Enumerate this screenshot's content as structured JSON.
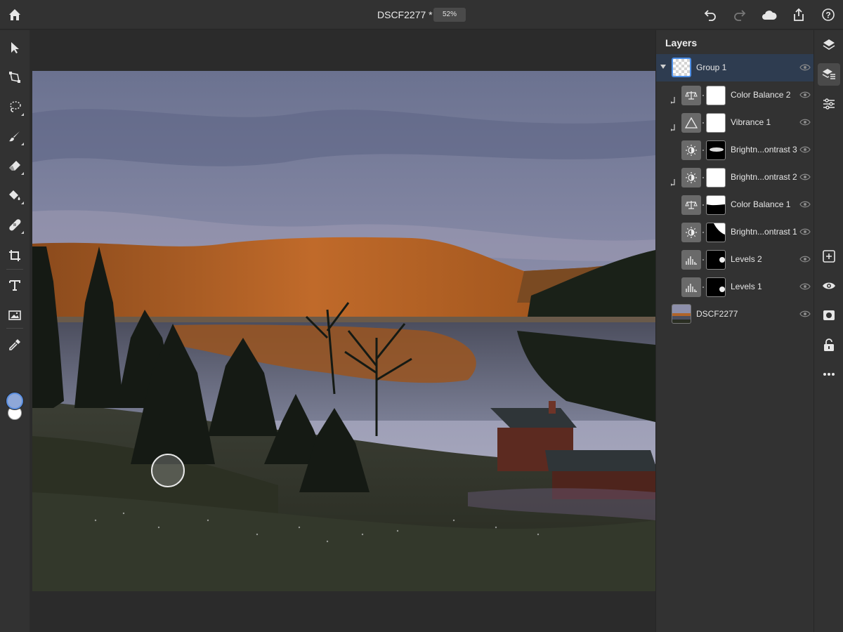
{
  "document": {
    "title": "DSCF2277 *",
    "zoom": "52%"
  },
  "topbar": {
    "icons": [
      "home-icon",
      "undo-icon",
      "redo-icon",
      "cloud-icon",
      "share-icon",
      "help-icon"
    ]
  },
  "toolbar": {
    "tools": [
      "select-icon",
      "transform-icon",
      "lasso-icon",
      "brush-icon",
      "eraser-icon",
      "fill-icon",
      "healing-icon",
      "crop-icon",
      "type-icon",
      "image-icon",
      "eyedropper-icon"
    ],
    "foreground_color": "#8fa8d8",
    "background_color": "#ffffff"
  },
  "layers": {
    "title": "Layers",
    "items": [
      {
        "name": "Group 1",
        "kind": "group",
        "selected": true
      },
      {
        "name": "Color Balance 2",
        "kind": "adjustment",
        "icon": "balance-icon",
        "clipped": true,
        "mask": "white"
      },
      {
        "name": "Vibrance 1",
        "kind": "adjustment",
        "icon": "triangle-icon",
        "clipped": true,
        "mask": "white"
      },
      {
        "name": "Brightn...ontrast 3",
        "kind": "adjustment",
        "icon": "brightness-icon",
        "clipped": false,
        "mask": "streak"
      },
      {
        "name": "Brightn...ontrast 2",
        "kind": "adjustment",
        "icon": "brightness-icon",
        "clipped": true,
        "mask": "white"
      },
      {
        "name": "Color Balance 1",
        "kind": "adjustment",
        "icon": "balance-icon",
        "clipped": false,
        "mask": "bottom-black"
      },
      {
        "name": "Brightn...ontrast 1",
        "kind": "adjustment",
        "icon": "brightness-icon",
        "clipped": false,
        "mask": "corner-black"
      },
      {
        "name": "Levels 2",
        "kind": "adjustment",
        "icon": "levels-icon",
        "clipped": false,
        "mask": "dot-black"
      },
      {
        "name": "Levels 1",
        "kind": "adjustment",
        "icon": "levels-icon",
        "clipped": false,
        "mask": "dot-black"
      },
      {
        "name": "DSCF2277",
        "kind": "image"
      }
    ]
  },
  "right_rail": {
    "icons": [
      "layers-icon",
      "layer-properties-icon",
      "adjustments-icon",
      "add-layer-icon",
      "visibility-icon",
      "mask-icon",
      "lock-icon",
      "more-icon"
    ]
  }
}
